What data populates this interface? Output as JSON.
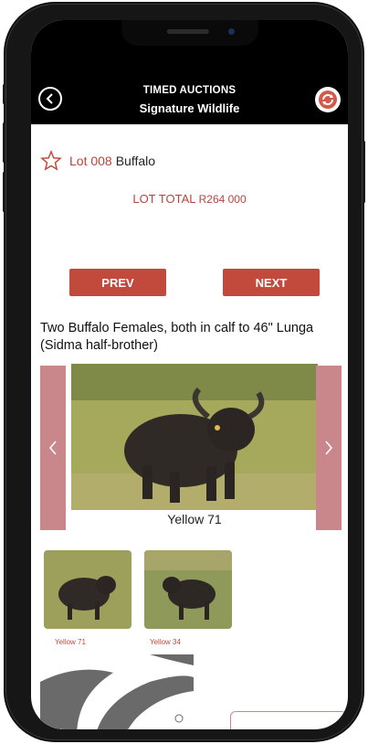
{
  "header": {
    "title": "TIMED AUCTIONS",
    "subtitle": "Signature Wildlife",
    "back_icon": "back-arrow-icon",
    "refresh_icon": "refresh-icon"
  },
  "lot": {
    "label": "Lot 008",
    "name": "Buffalo",
    "total_label": "LOT TOTAL",
    "total_value": "R264 000",
    "favorite_icon": "star-outline-icon"
  },
  "nav": {
    "prev_label": "PREV",
    "next_label": "NEXT"
  },
  "description": "Two Buffalo Females, both in calf to 46\" Lunga (Sidma half-brother)",
  "carousel": {
    "caption": "Yellow 71",
    "prev_icon": "chevron-left-icon",
    "next_icon": "chevron-right-icon"
  },
  "thumbnails": [
    {
      "caption": "Yellow 71"
    },
    {
      "caption": "Yellow 34"
    }
  ],
  "colors": {
    "accent": "#c24a3c",
    "arrow_bg": "#c9878c",
    "header_bg": "#000000"
  }
}
